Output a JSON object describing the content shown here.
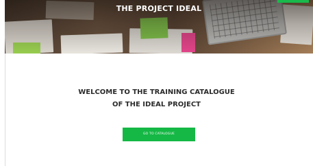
{
  "hero": {
    "title": "THE PROJECT IDEAL"
  },
  "welcome": {
    "line1": "WELCOME TO THE TRAINING CATALOGUE",
    "line2": "OF THE IDEAL PROJECT"
  },
  "cta": {
    "label": "GO TO CATALOGUE"
  },
  "colors": {
    "accent": "#15b845",
    "heading_text": "#2b2b2b",
    "background": "#ffffff"
  }
}
